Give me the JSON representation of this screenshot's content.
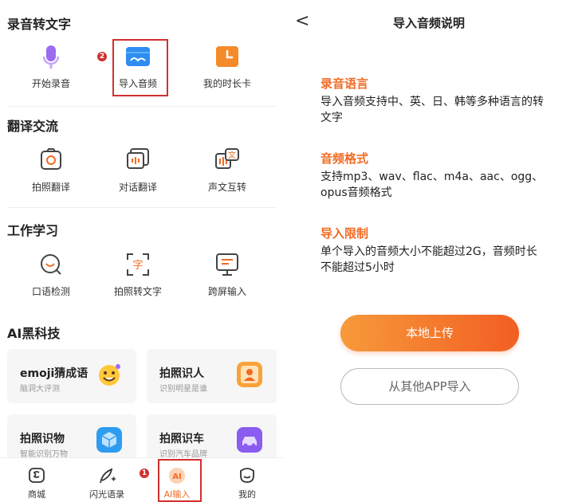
{
  "left": {
    "sections": {
      "recording": {
        "title": "录音转文字",
        "items": [
          "开始录音",
          "导入音频",
          "我的时长卡"
        ]
      },
      "translate": {
        "title": "翻译交流",
        "items": [
          "拍照翻译",
          "对话翻译",
          "声文互转"
        ]
      },
      "work": {
        "title": "工作学习",
        "items": [
          "口语检测",
          "拍照转文字",
          "跨屏输入"
        ],
        "icon_glyph": "字"
      },
      "ai": {
        "title": "AI黑科技",
        "cards": [
          {
            "title": "emoji猜成语",
            "subtitle": "脑洞大评测"
          },
          {
            "title": "拍照识人",
            "subtitle": "识别明星是谁"
          },
          {
            "title": "拍照识物",
            "subtitle": "智能识别万物"
          },
          {
            "title": "拍照识车",
            "subtitle": "识别汽车品牌"
          }
        ]
      }
    },
    "badges": {
      "step1": "1",
      "step2": "2"
    },
    "translate_icon_glyph": "文",
    "tabbar": [
      {
        "label": "商城",
        "icon": "shop-icon"
      },
      {
        "label": "闪光语录",
        "icon": "quill-icon"
      },
      {
        "label": "AI输入",
        "icon": "ai-input-icon",
        "glyph": "AI"
      },
      {
        "label": "我的",
        "icon": "profile-icon"
      }
    ]
  },
  "right": {
    "back_glyph": "<",
    "title": "导入音频说明",
    "sections": [
      {
        "heading": "录音语言",
        "body": "导入音频支持中、英、日、韩等多种语言的转文字"
      },
      {
        "heading": "音频格式",
        "body": "支持mp3、wav、flac、m4a、aac、ogg、opus音频格式"
      },
      {
        "heading": "导入限制",
        "body": "单个导入的音频大小不能超过2G，音频时长不能超过5小时"
      }
    ],
    "primary_button": "本地上传",
    "secondary_button": "从其他APP导入"
  },
  "colors": {
    "accent": "#f26a22",
    "highlight": "#d0302f",
    "purple": "#9b6cf0",
    "blue": "#2e8ef0"
  }
}
